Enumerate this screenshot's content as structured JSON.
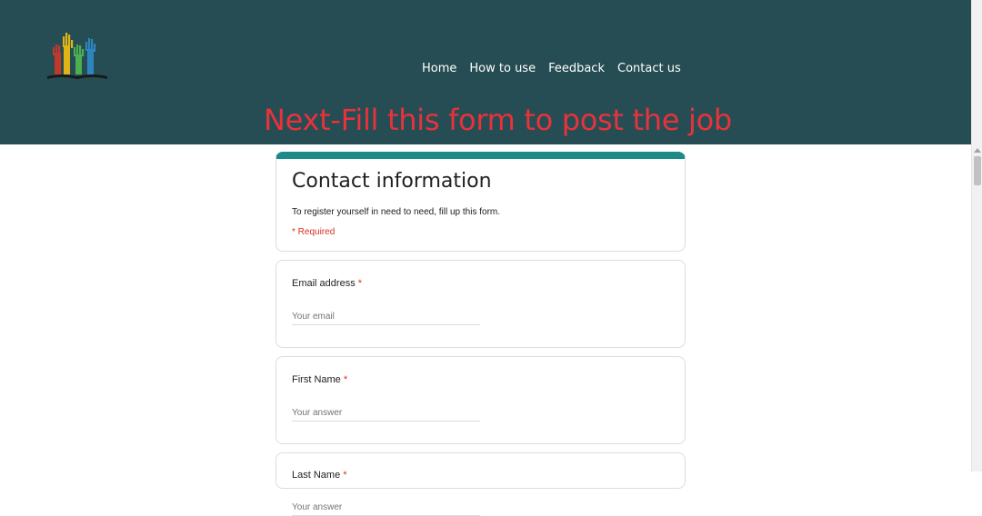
{
  "header": {
    "nav": [
      "Home",
      "How to use",
      "Feedback",
      "Contact us"
    ],
    "headline": "Next-Fill this form to post the job",
    "logo_icon": "raised-hands-logo-icon",
    "background_color": "#264d53",
    "headline_color": "#e8323c"
  },
  "form": {
    "title": "Contact information",
    "description": "To register yourself in need to need, fill up this form.",
    "required_note": "* Required",
    "accent_color": "#1c8a88",
    "questions": [
      {
        "label": "Email address",
        "required_mark": "*",
        "placeholder": "Your email",
        "value": ""
      },
      {
        "label": "First Name",
        "required_mark": "*",
        "placeholder": "Your answer",
        "value": ""
      },
      {
        "label": "Last Name",
        "required_mark": "*",
        "placeholder": "Your answer",
        "value": ""
      }
    ]
  }
}
